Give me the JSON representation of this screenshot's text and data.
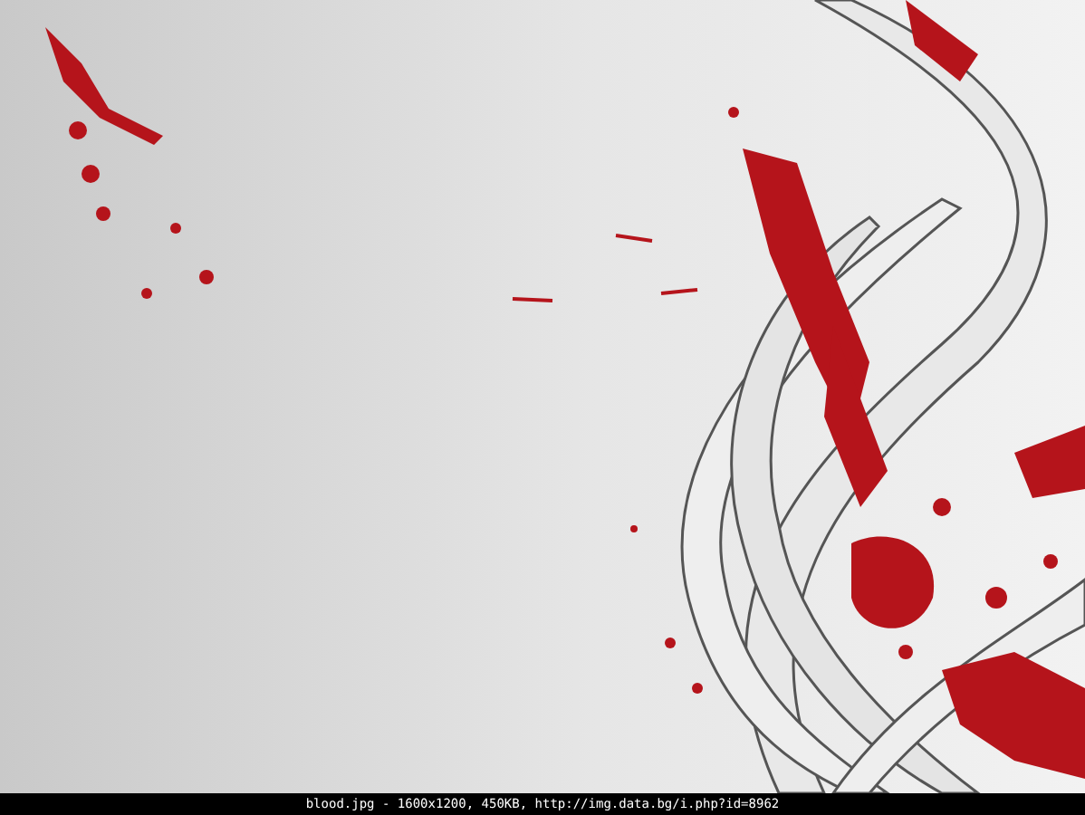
{
  "caption": {
    "text": "blood.jpg - 1600x1200, 450KB, http://img.data.bg/i.php?id=8962"
  }
}
